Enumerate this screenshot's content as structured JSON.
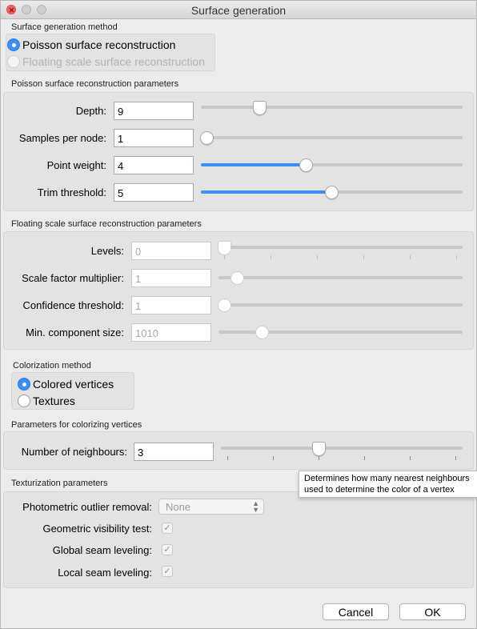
{
  "window": {
    "title": "Surface generation"
  },
  "surface_method": {
    "heading": "Surface generation method",
    "options": [
      {
        "label": "Poisson surface reconstruction",
        "selected": true,
        "enabled": true
      },
      {
        "label": "Floating scale surface reconstruction",
        "selected": false,
        "enabled": false
      }
    ]
  },
  "poisson": {
    "heading": "Poisson surface reconstruction parameters",
    "depth": {
      "label": "Depth:",
      "value": "9",
      "slider_fraction": 0.22
    },
    "samples": {
      "label": "Samples per node:",
      "value": "1",
      "slider_fraction": 0.0
    },
    "point_weight": {
      "label": "Point weight:",
      "value": "4",
      "slider_fraction": 0.4
    },
    "trim": {
      "label": "Trim threshold:",
      "value": "5",
      "slider_fraction": 0.5
    }
  },
  "floating": {
    "heading": "Floating scale surface reconstruction parameters",
    "levels": {
      "label": "Levels:",
      "value": "0",
      "slider_fraction": 0.0
    },
    "scale_factor": {
      "label": "Scale factor multiplier:",
      "value": "1",
      "slider_fraction": 0.07
    },
    "confidence": {
      "label": "Confidence threshold:",
      "value": "1",
      "slider_fraction": 0.0
    },
    "min_component": {
      "label": "Min. component size:",
      "value": "1010",
      "slider_fraction": 0.18
    }
  },
  "colorization": {
    "heading": "Colorization method",
    "options": [
      {
        "label": "Colored vertices",
        "selected": true
      },
      {
        "label": "Textures",
        "selected": false
      }
    ]
  },
  "vertex_params": {
    "heading": "Parameters for colorizing vertices",
    "neighbours": {
      "label": "Number of neighbours:",
      "value": "3",
      "slider_fraction": 0.4
    }
  },
  "tooltip": {
    "line1": "Determines how many nearest neighbours",
    "line2": "used to determine the color of a vertex"
  },
  "texturization": {
    "heading": "Texturization parameters",
    "outlier": {
      "label": "Photometric outlier removal:",
      "value": "None"
    },
    "geometric": {
      "label": "Geometric visibility test:",
      "checked": true
    },
    "global_seam": {
      "label": "Global seam leveling:",
      "checked": true
    },
    "local_seam": {
      "label": "Local seam leveling:",
      "checked": true
    }
  },
  "buttons": {
    "cancel": "Cancel",
    "ok": "OK"
  },
  "colors": {
    "accent": "#3b8ef3",
    "close": "#fc605c"
  },
  "icons": {
    "check": "✓",
    "select_arrows": "updown-chevron-icon"
  }
}
